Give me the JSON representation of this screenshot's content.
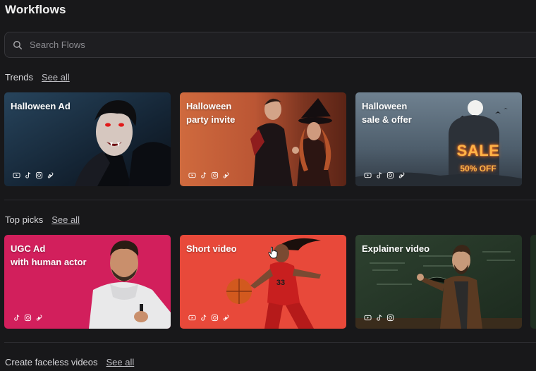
{
  "page": {
    "title": "Workflows"
  },
  "search": {
    "placeholder": "Search Flows"
  },
  "sections": [
    {
      "label": "Trends",
      "see_all": "See all",
      "cards": [
        {
          "title_lines": [
            "Halloween Ad"
          ],
          "platforms": [
            "youtube-icon",
            "tiktok-icon",
            "instagram-icon",
            "shorts-icon"
          ]
        },
        {
          "title_lines": [
            "Halloween",
            "party invite"
          ],
          "platforms": [
            "youtube-icon",
            "tiktok-icon",
            "instagram-icon",
            "shorts-icon"
          ]
        },
        {
          "title_lines": [
            "Halloween",
            "sale & offer"
          ],
          "sign_main": "SALE",
          "sign_sub": "50% OFF",
          "platforms": [
            "youtube-icon",
            "tiktok-icon",
            "instagram-icon",
            "shorts-icon"
          ]
        }
      ]
    },
    {
      "label": "Top picks",
      "see_all": "See all",
      "cards": [
        {
          "title_lines": [
            "UGC Ad",
            "with human actor"
          ],
          "platforms": [
            "tiktok-icon",
            "instagram-icon",
            "shorts-icon"
          ]
        },
        {
          "title_lines": [
            "Short video"
          ],
          "jersey": "33",
          "platforms": [
            "youtube-icon",
            "tiktok-icon",
            "instagram-icon",
            "shorts-icon"
          ]
        },
        {
          "title_lines": [
            "Explainer video"
          ],
          "platforms": [
            "youtube-icon",
            "tiktok-icon",
            "instagram-icon"
          ]
        }
      ]
    },
    {
      "label": "Create faceless videos",
      "see_all": "See all"
    }
  ],
  "colors": {
    "background": "#18181a",
    "card_trend_1": "#1d3347",
    "card_trend_2": "#c9623b",
    "card_trend_3": "#5d6d7c",
    "card_pick_1": "#d21f5c",
    "card_pick_2": "#e8493a",
    "card_pick_3": "#2a3a2a"
  }
}
